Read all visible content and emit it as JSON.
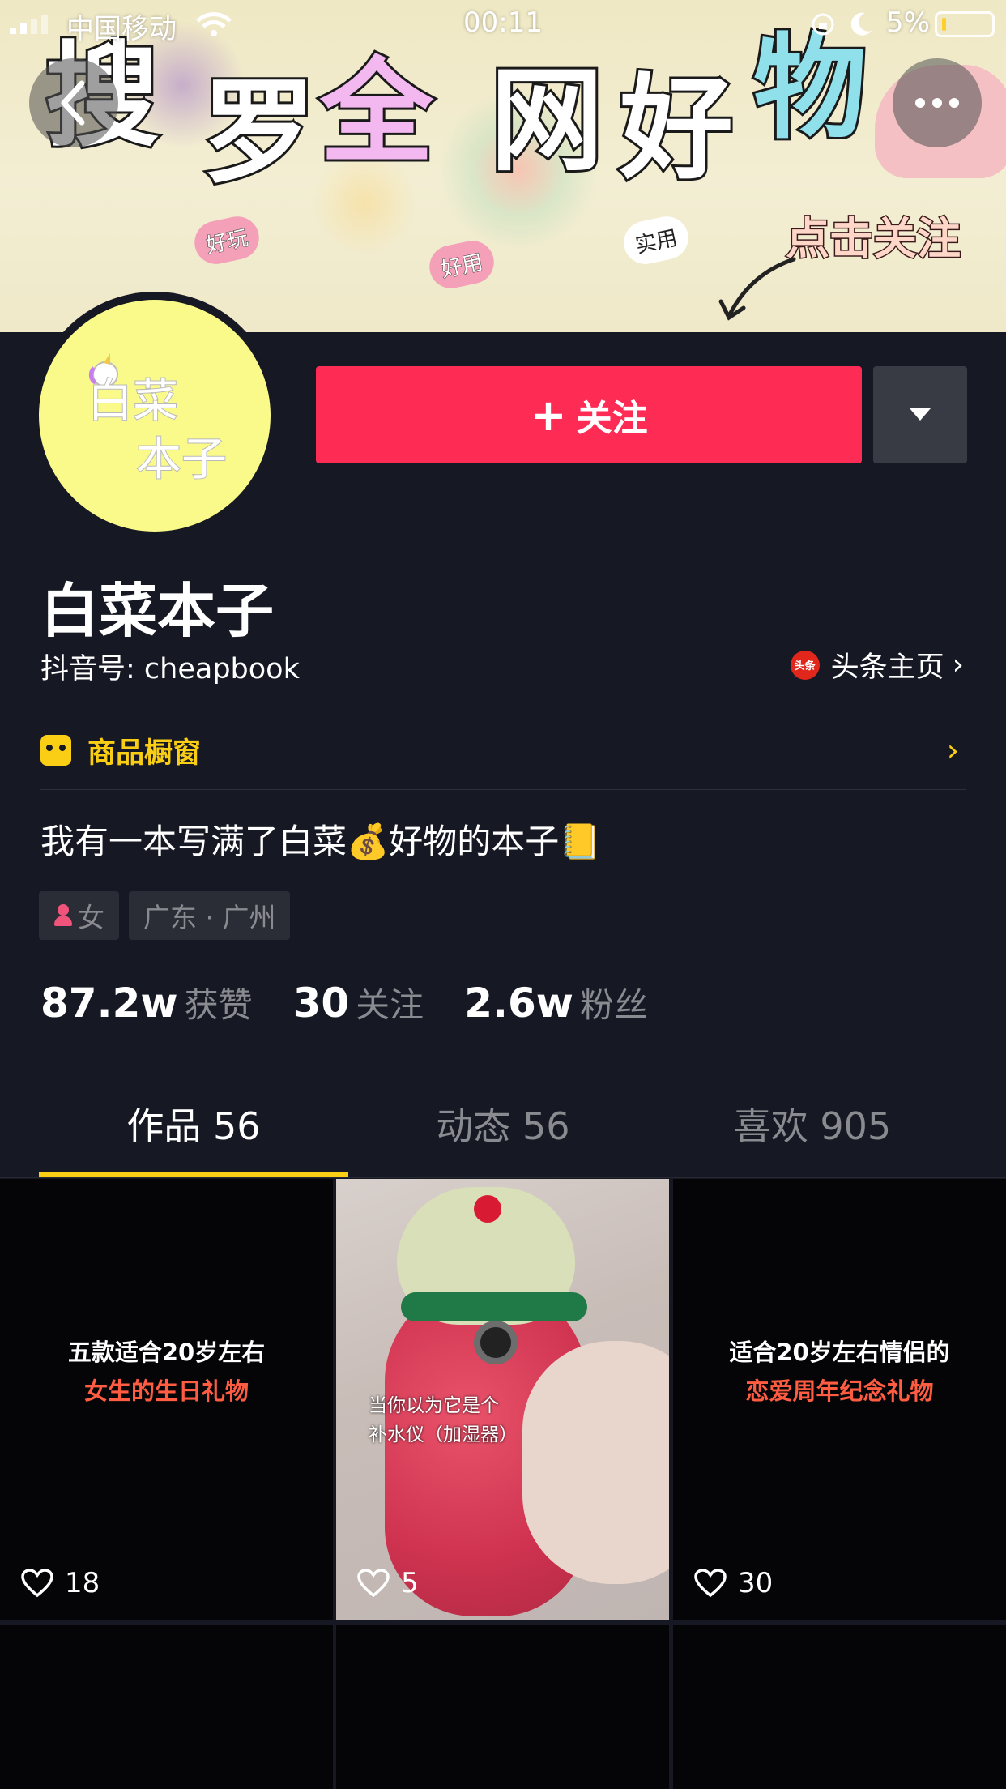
{
  "status_bar": {
    "carrier": "中国移动",
    "time": "00:11",
    "battery": "5%"
  },
  "banner": {
    "title_chars": [
      "搜",
      "罗",
      "全",
      "网",
      "好",
      "物"
    ],
    "cta": "点击关注",
    "stickers": [
      "好玩",
      "好用",
      "实用"
    ]
  },
  "avatar": {
    "line1": "白菜",
    "line2": "本子"
  },
  "actions": {
    "follow_plus": "+",
    "follow": "关注"
  },
  "profile": {
    "nickname": "白菜本子",
    "douyin_id": "抖音号: cheapbook",
    "toutiao_logo": "头条",
    "toutiao_label": "头条主页"
  },
  "shop": {
    "label": "商品橱窗"
  },
  "bio": "我有一本写满了白菜💰好物的本子📒",
  "tags": {
    "gender": "女",
    "location": "广东 · 广州"
  },
  "stats": [
    {
      "num": "87.2w",
      "label": "获赞"
    },
    {
      "num": "30",
      "label": "关注"
    },
    {
      "num": "2.6w",
      "label": "粉丝"
    }
  ],
  "tabs": [
    {
      "label": "作品 56"
    },
    {
      "label": "动态 56"
    },
    {
      "label": "喜欢 905"
    }
  ],
  "videos": [
    {
      "line1": "五款适合20岁左右",
      "line2": "女生的生日礼物",
      "likes": "18"
    },
    {
      "caption1": "当你以为它是个",
      "caption2": "补水仪（加湿器）",
      "likes": "5"
    },
    {
      "line1": "适合20岁左右情侣的",
      "line2": "恋爱周年纪念礼物",
      "likes": "30"
    }
  ],
  "colors": {
    "accent": "#fe2c55",
    "highlight": "#face15",
    "background": "#161823"
  }
}
